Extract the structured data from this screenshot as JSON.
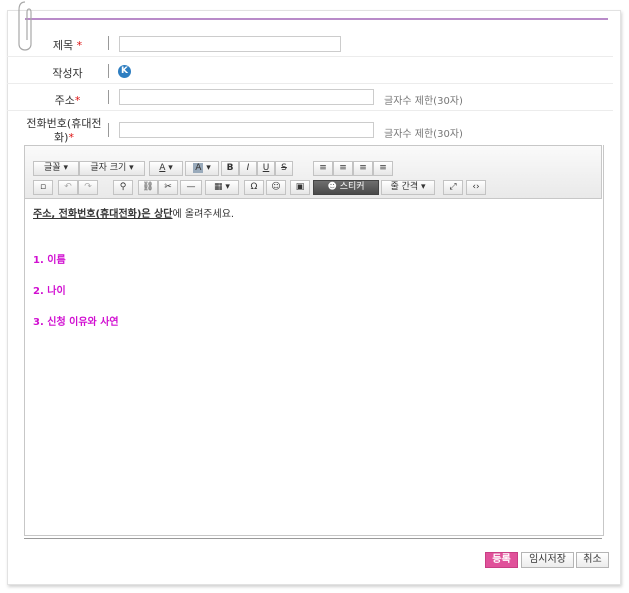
{
  "form": {
    "title_label": "제목",
    "title_required": "*",
    "title_value": "",
    "author_label": "작성자",
    "author_icon": "K",
    "address_label": "주소",
    "address_required": "*",
    "address_value": "",
    "address_hint": "글자수 제한(30자)",
    "phone_label_line1": "전화번호(휴대전",
    "phone_label_line2": "화)",
    "phone_required": "*",
    "phone_value": "",
    "phone_hint": "글자수 제한(30자)"
  },
  "toolbar": {
    "font": "글꼴",
    "font_size": "글자 크기",
    "bold": "B",
    "italic": "I",
    "underline": "U",
    "strike": "S",
    "text_color": "A",
    "bg_color": "A",
    "sticker": "스티커",
    "line_spacing": "줄 간격",
    "omega": "Ω",
    "code": "‹›"
  },
  "content": {
    "intro_underlined": "주소, 전화번호(휴대전화)은 상단",
    "intro_rest": "에 올려주세요.",
    "item1": "1. 이름",
    "item2": "2. 나이",
    "item3": "3. 신청 이유와 사연"
  },
  "buttons": {
    "submit": "등록",
    "temp_save": "임시저장",
    "cancel": "취소"
  },
  "colors": {
    "accent_line": "#b98bc9",
    "required": "#dd1111",
    "content_pink": "#d10fd1",
    "submit_button": "#e0519a",
    "author_icon": "#2e7ec1"
  }
}
